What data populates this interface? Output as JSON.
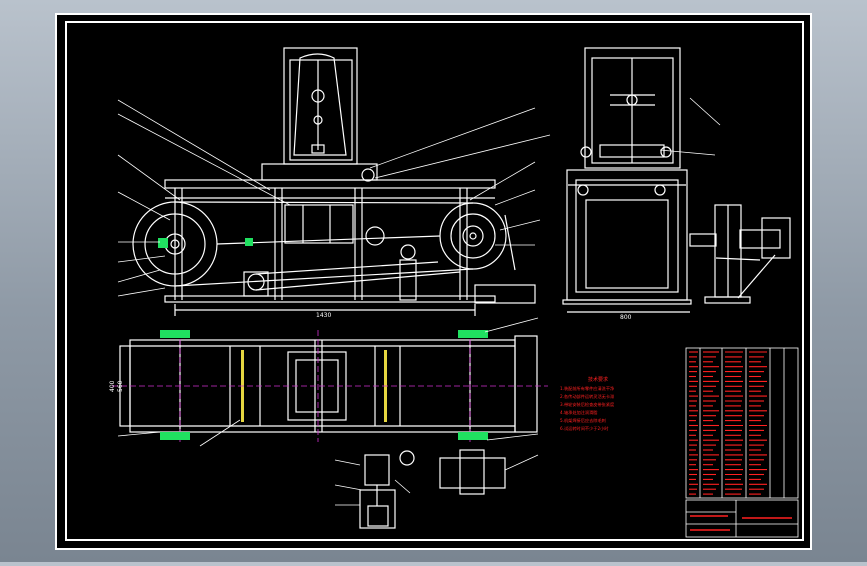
{
  "drawing": {
    "background_color": "#000000",
    "line_color": "#ffffff",
    "annotation_color": "#ff2020",
    "centerline_color": "#d030d0",
    "highlight_color": "#20e060",
    "dimensions": {
      "front_length": "1430",
      "side_width": "800",
      "plan_width_1": "400",
      "plan_width_2": "560"
    },
    "notes_title": "技术要求",
    "notes": [
      "1.装配前所有零件应清洗干净",
      "2.各传动部件运转灵活无卡滞",
      "3.带轮安装后检查皮带张紧度",
      "4.轴承处加注润滑脂",
      "5.机架焊接后应去除毛刺",
      "6.试运转时间不少于2小时"
    ]
  }
}
